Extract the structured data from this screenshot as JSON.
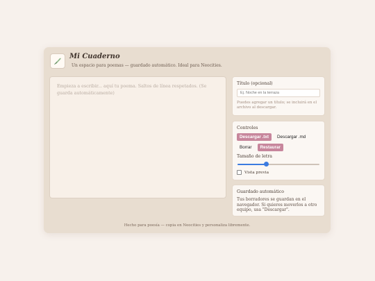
{
  "app": {
    "title": "Mi Cuaderno",
    "subtitle": "Un espacio para poemas — guardado automático. Ideal para Neocities.",
    "logo_icon": "feather-pen-icon"
  },
  "editor": {
    "placeholder": "Empieza a escribir... aquí tu poema. Saltos de línea respetados. (Se guarda automáticamente)"
  },
  "title_panel": {
    "label": "Título (opcional)",
    "input_placeholder": "Ej. Noche en la terraza",
    "hint": "Puedes agregar un título; se incluirá en el archivo al descargar."
  },
  "controls": {
    "label": "Controles",
    "download_txt": "Descargar .txt",
    "download_md": "Descargar .md",
    "clear": "Borrar",
    "restore": "Restaurar",
    "font_size_label": "Tamaño de letra",
    "font_size_fraction": 0.35,
    "preview_label": "Vista previa",
    "preview_checked": false
  },
  "autosave": {
    "label": "Guardado automático",
    "text": "Tus borradores se guardan en el navegador. Si quieres moverlos a otro equipo, usa \"Descargar\"."
  },
  "footer": {
    "text": "Hecho para poesía — copia en Neocities y personaliza libremente."
  },
  "colors": {
    "accent": "#c7869c",
    "card_bg": "#e8ddd0",
    "page_bg": "#f7f1ec",
    "slider": "#3b7be0"
  }
}
